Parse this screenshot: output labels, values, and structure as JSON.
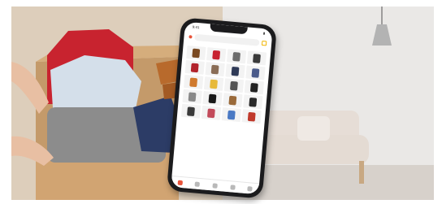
{
  "banner": {
    "phone_app": {
      "status_time": "9:41",
      "search_text": "",
      "section_title": "",
      "accent_color": "#e8543b",
      "items": [
        {
          "icon": "shoes-icon",
          "color": "#7a4a22"
        },
        {
          "icon": "jacket-icon",
          "color": "#c82331"
        },
        {
          "icon": "coat-icon",
          "color": "#6c6c6c"
        },
        {
          "icon": "coat-icon",
          "color": "#3b3b3b"
        },
        {
          "icon": "dress-icon",
          "color": "#b2232c"
        },
        {
          "icon": "book-icon",
          "color": "#8a6d56"
        },
        {
          "icon": "bag-icon",
          "color": "#2f3a57"
        },
        {
          "icon": "shirt-icon",
          "color": "#4b5b8a"
        },
        {
          "icon": "box-icon",
          "color": "#d07a2e"
        },
        {
          "icon": "card-icon",
          "color": "#e7b93a"
        },
        {
          "icon": "controller-icon",
          "color": "#555555"
        },
        {
          "icon": "jacket-icon",
          "color": "#222222"
        },
        {
          "icon": "watch-icon",
          "color": "#888888"
        },
        {
          "icon": "sunglasses-icon",
          "color": "#1a1a1a"
        },
        {
          "icon": "bag-icon",
          "color": "#9a6a3a"
        },
        {
          "icon": "coat-icon",
          "color": "#2a2a2a"
        },
        {
          "icon": "boots-icon",
          "color": "#3a3a3a"
        },
        {
          "icon": "book-icon",
          "color": "#c24a5a"
        },
        {
          "icon": "clock-icon",
          "color": "#4a79c4"
        },
        {
          "icon": "can-icon",
          "color": "#c0392b"
        }
      ],
      "tabs": [
        "home-icon",
        "search-icon",
        "camera-icon",
        "bell-icon",
        "user-icon"
      ]
    }
  }
}
